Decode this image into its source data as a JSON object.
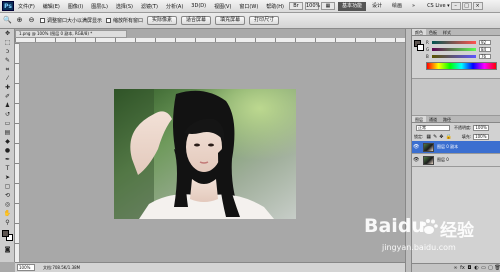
{
  "menubar": {
    "app_logo": "Ps",
    "items": [
      "文件(F)",
      "编辑(E)",
      "图像(I)",
      "图层(L)",
      "选择(S)",
      "滤镜(T)",
      "分析(A)",
      "3D(D)",
      "视图(V)",
      "窗口(W)",
      "帮助(H)"
    ],
    "zoom_value": "100%",
    "workspace_buttons": [
      "基本功能",
      "设计",
      "绘画"
    ],
    "more": "»",
    "cs_live": "CS Live ▾"
  },
  "options": {
    "checkbox1_label": "调整窗口大小以满屏显示",
    "checkbox2_label": "缩放所有窗口",
    "buttons": [
      "实际像素",
      "适合屏幕",
      "填充屏幕",
      "打印尺寸"
    ]
  },
  "document": {
    "tab_title": "1.png @ 100% (图层 0 副本, RGB/8) *",
    "zoom": "100%",
    "doc_info": "文档:708.5K/1.38M"
  },
  "panels": {
    "color_tabs": [
      "颜色",
      "色板",
      "样式"
    ],
    "channels": [
      {
        "label": "R",
        "value": "92"
      },
      {
        "label": "G",
        "value": "84"
      },
      {
        "label": "B",
        "value": "76"
      }
    ],
    "layers_tabs": [
      "图层",
      "通道",
      "路径"
    ],
    "blend_mode": "正常",
    "opacity_label": "不透明度:",
    "opacity_value": "100%",
    "lock_label": "锁定:",
    "fill_label": "填充:",
    "fill_value": "100%",
    "layers": [
      {
        "name": "图层 0 副本"
      },
      {
        "name": "图层 0"
      }
    ]
  },
  "watermark": {
    "brand": "Baidu",
    "cn": "经验",
    "url": "jingyan.baidu.com"
  },
  "colors": {
    "selected_layer": "#3b6fd0",
    "foreground": "#5c5450",
    "background": "#ffffff"
  }
}
